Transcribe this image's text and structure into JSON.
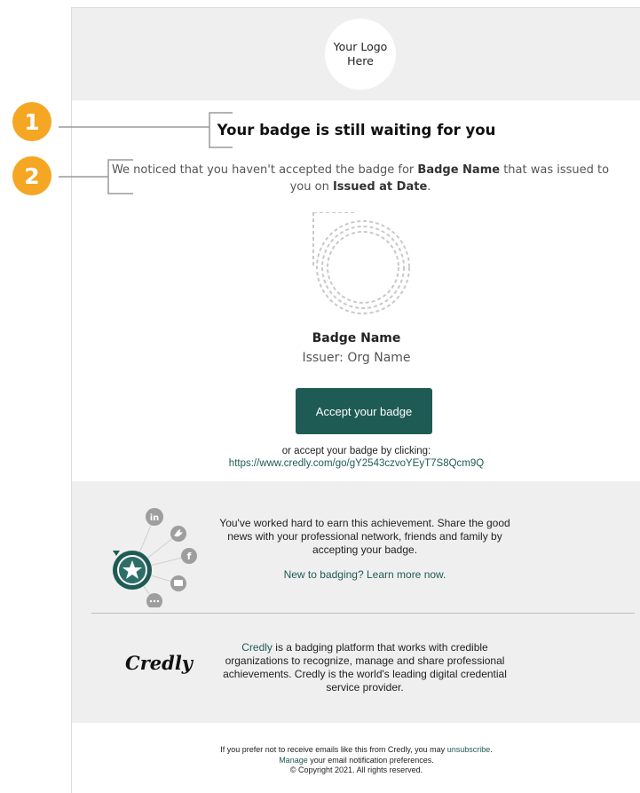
{
  "header": {
    "logo_text": "Your Logo\nHere"
  },
  "content": {
    "title": "Your badge is still waiting for you",
    "notice_prefix": "We noticed that you haven't accepted the badge for ",
    "notice_badge_name": "Badge Name",
    "notice_middle": " that was issued to you on ",
    "notice_date": "Issued at Date",
    "notice_suffix": ".",
    "badge_name": "Badge Name",
    "badge_issuer": "Issuer: Org Name",
    "accept_button": "Accept your badge",
    "or_text": "or accept your badge by clicking:",
    "badge_link": "https://www.credly.com/go/gY2543czvoYEyT7S8Qcm9Q"
  },
  "share": {
    "text": "You've worked hard to earn this achievement. Share the good news with your professional network, friends and family by accepting your badge.",
    "learn_more": "New to badging? Learn more now.",
    "icons": [
      "linkedin-icon",
      "twitter-icon",
      "facebook-icon",
      "email-icon",
      "more-icon"
    ]
  },
  "credly": {
    "logo": "Credly",
    "brand": "Credly",
    "description": " is a badging platform that works with credible organizations to recognize, manage and share professional achievements. Credly is the world's leading digital credential service provider."
  },
  "footer": {
    "line1_prefix": "If you prefer not to receive emails like this from Credly, you may ",
    "unsubscribe": "unsubscribe",
    "line1_suffix": ".",
    "manage": "Manage",
    "line2_suffix": " your email notification preferences.",
    "copyright": "© Copyright 2021. All rights reserved."
  },
  "markers": {
    "one": "1",
    "two": "2"
  },
  "colors": {
    "accent": "#1f5b55",
    "marker": "#f5a623",
    "section_bg": "#efefef"
  }
}
